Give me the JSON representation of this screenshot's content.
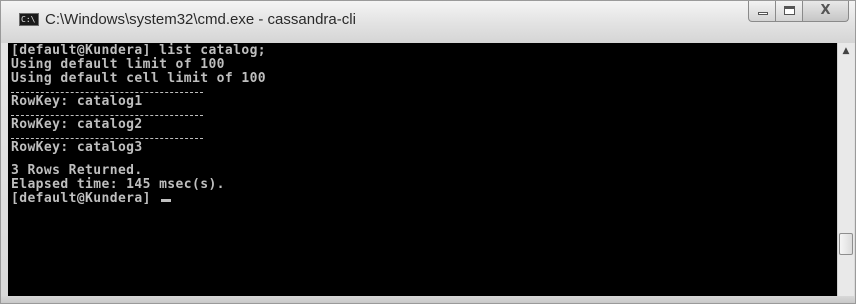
{
  "window": {
    "title": "C:\\Windows\\system32\\cmd.exe - cassandra-cli",
    "app_icon_text": "C:\\",
    "controls": {
      "minimize": "minimize-icon",
      "maximize": "maximize-icon",
      "close_glyph": "X"
    }
  },
  "console": {
    "lines": [
      {
        "kind": "text",
        "text": "[default@Kundera] list catalog;"
      },
      {
        "kind": "text",
        "text": "Using default limit of 100"
      },
      {
        "kind": "text",
        "text": "Using default cell limit of 100"
      },
      {
        "kind": "separator",
        "text": ""
      },
      {
        "kind": "text",
        "text": "RowKey: catalog1"
      },
      {
        "kind": "separator",
        "text": ""
      },
      {
        "kind": "text",
        "text": "RowKey: catalog2"
      },
      {
        "kind": "separator",
        "text": ""
      },
      {
        "kind": "text",
        "text": "RowKey: catalog3"
      },
      {
        "kind": "blank",
        "text": ""
      },
      {
        "kind": "text",
        "text": "3 Rows Returned."
      },
      {
        "kind": "text",
        "text": "Elapsed time: 145 msec(s)."
      },
      {
        "kind": "prompt",
        "text": "[default@Kundera] "
      }
    ],
    "text_color": "#bfbfbf",
    "background": "#000000"
  },
  "scrollbar": {
    "up_arrow": "▲"
  }
}
